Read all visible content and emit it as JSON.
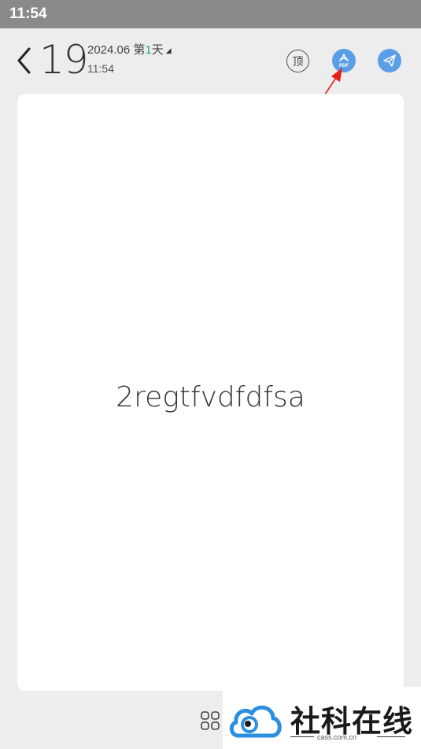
{
  "status_bar": {
    "time": "11:54"
  },
  "header": {
    "day_number": "19",
    "date_prefix": "2024.06 第",
    "day_index": "1",
    "date_suffix": "天",
    "time": "11:54",
    "pin_label": "顶",
    "pdf_label": "PDF"
  },
  "note": {
    "content": "2regtfvdfdfsa"
  },
  "watermark": {
    "brand": "社科在线",
    "url": "cass.com.cn"
  },
  "colors": {
    "accent_blue": "#5b9ee8",
    "annotation_red": "#e8201c",
    "status_bar": "#8a8a8a",
    "background": "#ededed"
  },
  "icons": [
    "back-icon",
    "pin-icon",
    "pdf-icon",
    "send-icon",
    "grid-icon",
    "watermark-logo-icon"
  ]
}
